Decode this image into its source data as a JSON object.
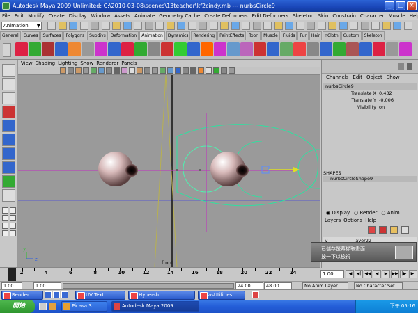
{
  "window": {
    "title": "Autodesk Maya 2009 Unlimited: C:\\2010-03-08\\scenes\\13teacher\\kf2cindy.mb  ---  nurbsCircle9"
  },
  "menubar": [
    "File",
    "Edit",
    "Modify",
    "Create",
    "Display",
    "Window",
    "Assets",
    "Animate",
    "Geometry Cache",
    "Create Deformers",
    "Edit Deformers",
    "Skeleton",
    "Skin",
    "Constrain",
    "Character",
    "Muscle",
    "Help"
  ],
  "mode_menu": {
    "value": "Animation"
  },
  "shelf_tabs": [
    "General",
    "Curves",
    "Surfaces",
    "Polygons",
    "Subdivs",
    "Deformation",
    "Animation",
    "Dynamics",
    "Rendering",
    "PaintEffects",
    "Toon",
    "Muscle",
    "Fluids",
    "Fur",
    "Hair",
    "nCloth",
    "Custom",
    "Skeleton"
  ],
  "active_shelf_tab": "Animation",
  "viewport": {
    "menu": [
      "View",
      "Shading",
      "Lighting",
      "Show",
      "Renderer",
      "Panels"
    ],
    "camera_label": "front",
    "axis_y": "y",
    "axis_z": "z"
  },
  "channel_box": {
    "menu": [
      "Channels",
      "Edit",
      "Object",
      "Show"
    ],
    "object_name": "nurbsCircle9",
    "channels": [
      {
        "name": "Translate X",
        "value": "0.432"
      },
      {
        "name": "Translate Y",
        "value": "-0.006"
      },
      {
        "name": "Visibility",
        "value": "on"
      }
    ],
    "shapes_header": "SHAPES",
    "shape_name": "nurbsCircleShape9"
  },
  "layer_editor": {
    "options": [
      "Display",
      "Render",
      "Anim"
    ],
    "selected": "Display",
    "menu": [
      "Layers",
      "Options",
      "Help"
    ],
    "layer_row": {
      "visibility": "V",
      "name": "layer22"
    }
  },
  "timeline": {
    "ticks": [
      "2",
      "4",
      "6",
      "8",
      "10",
      "12",
      "14",
      "16",
      "18",
      "20",
      "22",
      "24"
    ],
    "current_frame": "1.00"
  },
  "range_slider": {
    "start": "1.00",
    "inner_start": "1.00",
    "inner_end": "24.00",
    "end": "48.00",
    "anim_layer": "No Anim Layer",
    "character_set": "No Character Set"
  },
  "taskbar_windows": [
    {
      "label": "Render ..."
    },
    {
      "label": "UV Text..."
    },
    {
      "label": "Hypersh..."
    },
    {
      "label": "asUtilities"
    }
  ],
  "taskbar": {
    "start_label": "開始",
    "items": [
      {
        "label": "Picasa 3",
        "active": false
      },
      {
        "label": "Autodesk Maya 2009 ...",
        "active": true
      }
    ],
    "clock": "下午 05:16"
  },
  "notification": {
    "line1": "已儲存螢幕擷取畫面",
    "line2": "按一下以檢視"
  },
  "colors": {
    "viewport_bg": "#9a9a9a",
    "curve": "#2fe0a0",
    "axis": "#c02ec0",
    "title_blue": "#1a46b8"
  }
}
